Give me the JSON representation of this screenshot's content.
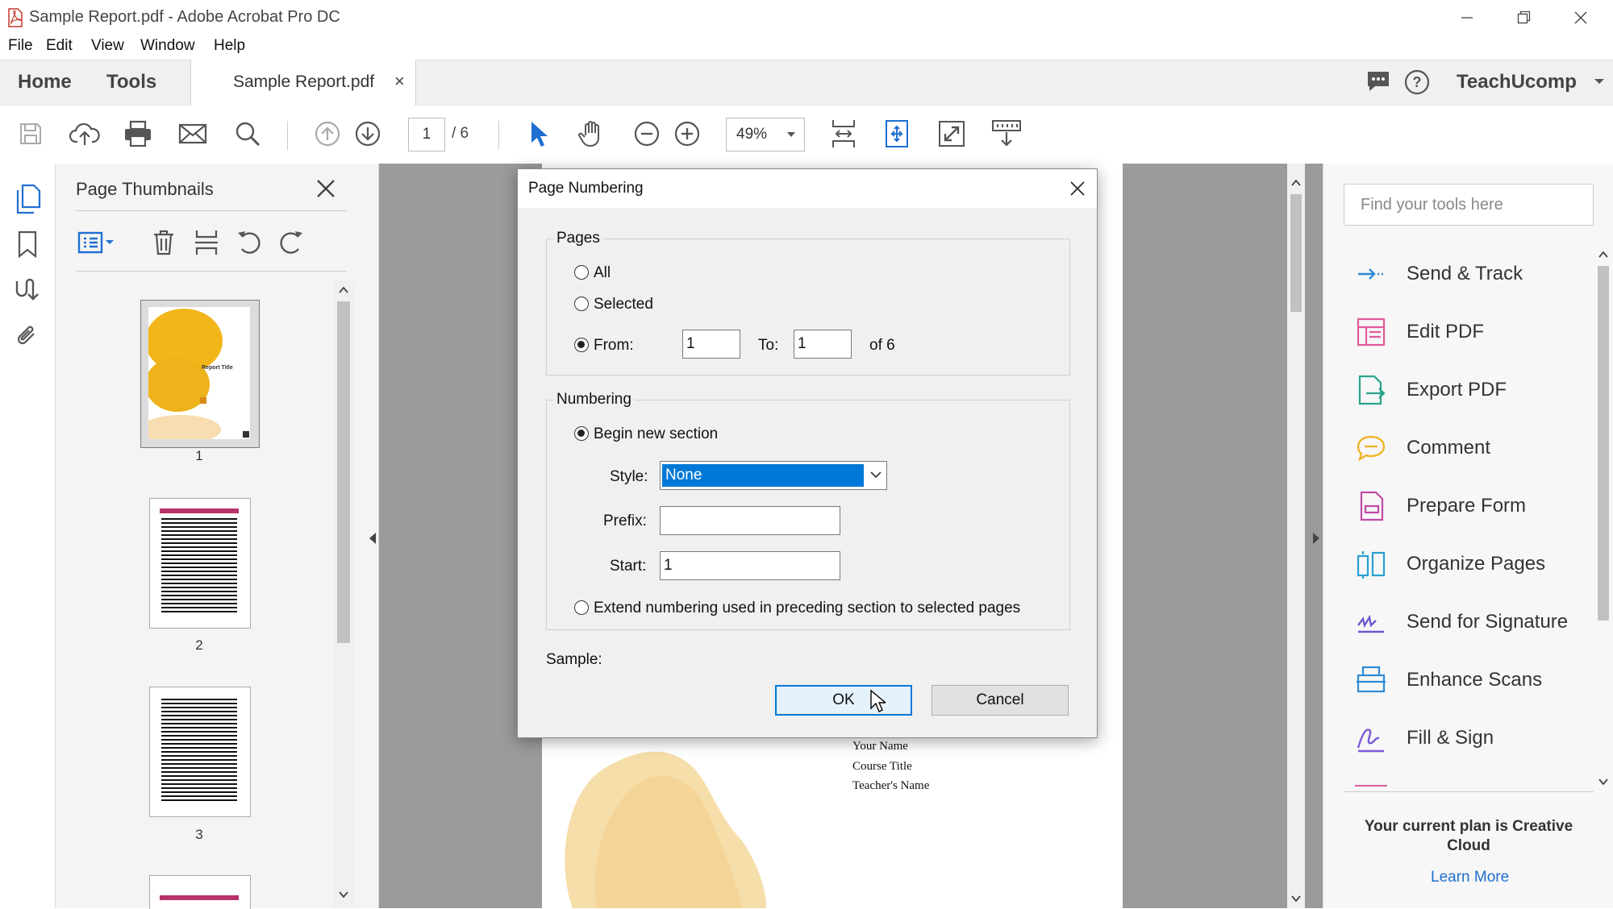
{
  "window": {
    "title": "Sample Report.pdf - Adobe Acrobat Pro DC"
  },
  "menu": {
    "file": "File",
    "edit": "Edit",
    "view": "View",
    "window": "Window",
    "help": "Help"
  },
  "tabs": {
    "home": "Home",
    "tools": "Tools",
    "document": "Sample Report.pdf",
    "close_glyph": "×"
  },
  "account": {
    "name": "TeachUcomp"
  },
  "toolbar": {
    "current_page": "1",
    "page_total": "/ 6",
    "zoom": "49%"
  },
  "thumbnails": {
    "title": "Page Thumbnails",
    "pages": [
      {
        "caption": "1"
      },
      {
        "caption": "2"
      },
      {
        "caption": "3"
      }
    ],
    "cover_title": "Report Title"
  },
  "document_page": {
    "lines": [
      "Your Name",
      "Course Title",
      "Teacher's Name"
    ]
  },
  "tools_pane": {
    "search_placeholder": "Find your tools here",
    "items": [
      {
        "label": "Send & Track",
        "color": "#2d8bd6"
      },
      {
        "label": "Edit PDF",
        "color": "#e05a9a"
      },
      {
        "label": "Export PDF",
        "color": "#2aa38b"
      },
      {
        "label": "Comment",
        "color": "#f0b52b"
      },
      {
        "label": "Prepare Form",
        "color": "#c04aa6"
      },
      {
        "label": "Organize Pages",
        "color": "#29a0d0"
      },
      {
        "label": "Send for Signature",
        "color": "#6a5acd"
      },
      {
        "label": "Enhance Scans",
        "color": "#2d8bd6"
      },
      {
        "label": "Fill & Sign",
        "color": "#7b5bd6"
      }
    ],
    "plan_text": "Your current plan is Creative Cloud",
    "learn_more": "Learn More"
  },
  "dialog": {
    "title": "Page Numbering",
    "pages_group": "Pages",
    "all": "All",
    "selected": "Selected",
    "from": "From:",
    "from_value": "1",
    "to": "To:",
    "to_value": "1",
    "of": "of 6",
    "numbering_group": "Numbering",
    "begin_new": "Begin new section",
    "style_label": "Style:",
    "style_value": "None",
    "prefix_label": "Prefix:",
    "prefix_value": "",
    "start_label": "Start:",
    "start_value": "1",
    "extend": "Extend numbering used in preceding section to selected pages",
    "sample": "Sample:",
    "ok": "OK",
    "cancel": "Cancel"
  }
}
